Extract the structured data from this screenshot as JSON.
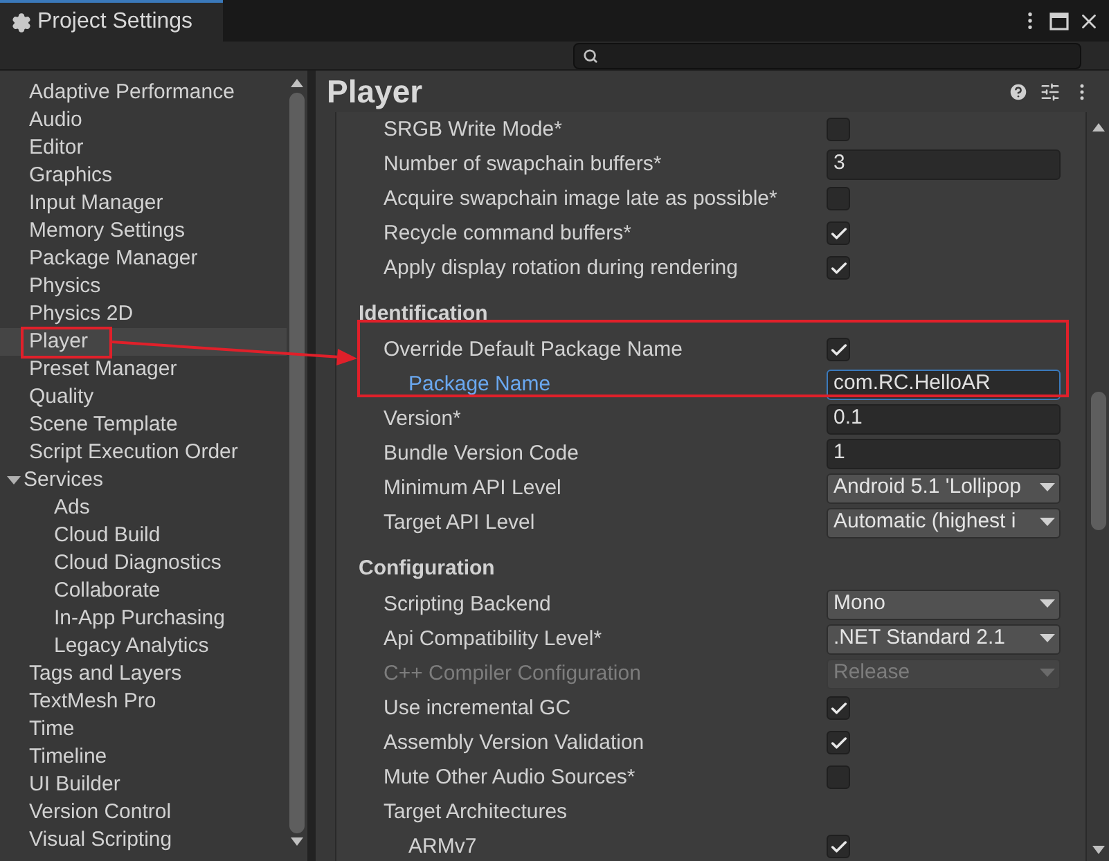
{
  "window": {
    "title": "Project Settings"
  },
  "sidebar": {
    "items": [
      {
        "label": "Adaptive Performance",
        "selected": false
      },
      {
        "label": "Audio",
        "selected": false
      },
      {
        "label": "Editor",
        "selected": false
      },
      {
        "label": "Graphics",
        "selected": false
      },
      {
        "label": "Input Manager",
        "selected": false
      },
      {
        "label": "Memory Settings",
        "selected": false
      },
      {
        "label": "Package Manager",
        "selected": false
      },
      {
        "label": "Physics",
        "selected": false
      },
      {
        "label": "Physics 2D",
        "selected": false
      },
      {
        "label": "Player",
        "selected": true
      },
      {
        "label": "Preset Manager",
        "selected": false
      },
      {
        "label": "Quality",
        "selected": false
      },
      {
        "label": "Scene Template",
        "selected": false
      },
      {
        "label": "Script Execution Order",
        "selected": false
      },
      {
        "label": "Services",
        "selected": false,
        "expanded": true,
        "children": [
          {
            "label": "Ads",
            "selected": false
          },
          {
            "label": "Cloud Build",
            "selected": false
          },
          {
            "label": "Cloud Diagnostics",
            "selected": false
          },
          {
            "label": "Collaborate",
            "selected": false
          },
          {
            "label": "In-App Purchasing",
            "selected": false
          },
          {
            "label": "Legacy Analytics",
            "selected": false
          }
        ]
      },
      {
        "label": "Tags and Layers",
        "selected": false
      },
      {
        "label": "TextMesh Pro",
        "selected": false
      },
      {
        "label": "Time",
        "selected": false
      },
      {
        "label": "Timeline",
        "selected": false
      },
      {
        "label": "UI Builder",
        "selected": false
      },
      {
        "label": "Version Control",
        "selected": false
      },
      {
        "label": "Visual Scripting",
        "selected": false
      }
    ]
  },
  "header": {
    "title": "Player"
  },
  "sections": [
    {
      "rows": [
        {
          "kind": "checkbox",
          "label": "SRGB Write Mode*",
          "checked": false
        },
        {
          "kind": "text",
          "label": "Number of swapchain buffers*",
          "value": "3"
        },
        {
          "kind": "checkbox",
          "label": "Acquire swapchain image late as possible*",
          "checked": false
        },
        {
          "kind": "checkbox",
          "label": "Recycle command buffers*",
          "checked": true
        },
        {
          "kind": "checkbox",
          "label": "Apply display rotation during rendering",
          "checked": true
        }
      ]
    },
    {
      "title": "Identification",
      "rows": [
        {
          "kind": "checkbox",
          "label": "Override Default Package Name",
          "checked": true,
          "children": [
            {
              "kind": "text",
              "label": "Package Name",
              "value": "com.RC.HelloAR",
              "focused": true
            }
          ]
        },
        {
          "kind": "text",
          "label": "Version*",
          "value": "0.1"
        },
        {
          "kind": "text",
          "label": "Bundle Version Code",
          "value": "1"
        },
        {
          "kind": "dropdown",
          "label": "Minimum API Level",
          "value": "Android 5.1 'Lollipop"
        },
        {
          "kind": "dropdown",
          "label": "Target API Level",
          "value": "Automatic (highest i"
        }
      ]
    },
    {
      "title": "Configuration",
      "rows": [
        {
          "kind": "dropdown",
          "label": "Scripting Backend",
          "value": "Mono"
        },
        {
          "kind": "dropdown",
          "label": "Api Compatibility Level*",
          "value": ".NET Standard 2.1"
        },
        {
          "kind": "dropdown",
          "label": "C++ Compiler Configuration",
          "value": "Release",
          "disabled": true
        },
        {
          "kind": "checkbox",
          "label": "Use incremental GC",
          "checked": true
        },
        {
          "kind": "checkbox",
          "label": "Assembly Version Validation",
          "checked": true
        },
        {
          "kind": "checkbox",
          "label": "Mute Other Audio Sources*",
          "checked": false
        },
        {
          "kind": "label",
          "label": "Target Architectures",
          "children": [
            {
              "kind": "checkbox",
              "label": "ARMv7",
              "checked": true
            }
          ]
        }
      ]
    }
  ]
}
